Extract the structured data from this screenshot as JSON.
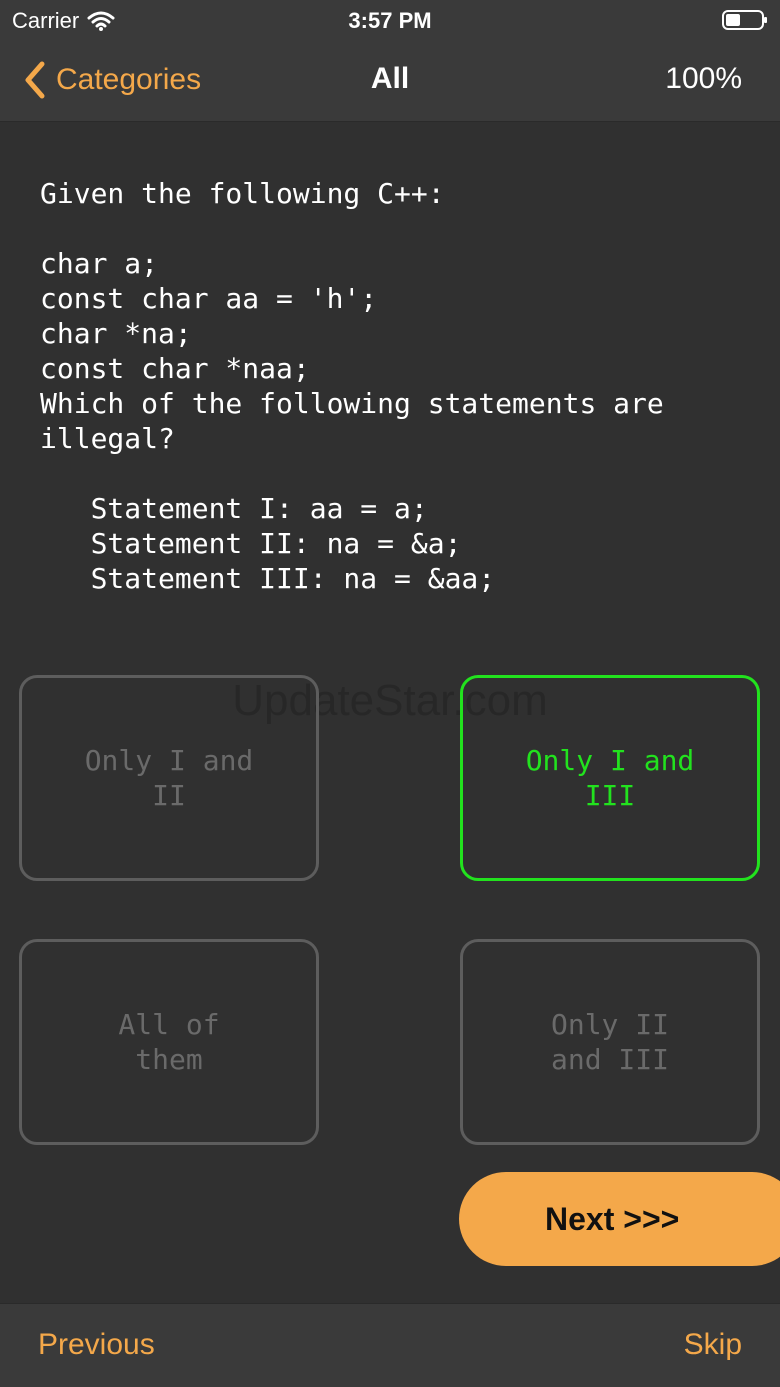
{
  "status_bar": {
    "carrier": "Carrier",
    "time": "3:57 PM"
  },
  "nav": {
    "back_label": "Categories",
    "title": "All",
    "progress": "100%"
  },
  "question": {
    "text": "Given the following C++:\n\nchar a;\nconst char aa = 'h';\nchar *na;\nconst char *naa;\nWhich of the following statements are\nillegal?\n\n   Statement I: aa = a;\n   Statement II: na = &a;\n   Statement III: na = &aa;"
  },
  "watermark": "UpdateStar.com",
  "options": [
    {
      "label": "Only I and II",
      "selected": false
    },
    {
      "label": "Only I and III",
      "selected": true
    },
    {
      "label": "All of them",
      "selected": false
    },
    {
      "label": "Only II and III",
      "selected": false
    }
  ],
  "next_label": "Next >>>",
  "bottom_bar": {
    "previous_label": "Previous",
    "skip_label": "Skip"
  },
  "colors": {
    "accent": "#f4a84a",
    "selected": "#22e21e",
    "background": "#303030",
    "bar": "#3a3a3a"
  },
  "icons": {
    "wifi": "wifi-icon",
    "battery": "battery-icon",
    "back": "back-chevron-icon"
  }
}
